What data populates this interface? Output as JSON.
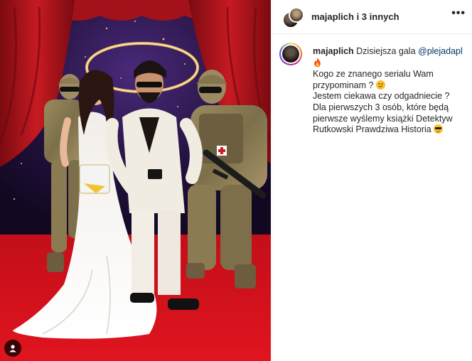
{
  "post": {
    "header": {
      "user_name": "majaplich i 3 innych",
      "more_icon": "more-horizontal-icon"
    },
    "caption": {
      "username": "majaplich",
      "intro": "Dzisiejsza gala",
      "mention": "@plejadapl",
      "line1": "Kogo ze znanego serialu Wam przypominam ?",
      "line2": "Jestem ciekawa czy odgadniecie ?",
      "line3": "Dla pierwszych 3 osób, które będą pierwsze wyślemy książki Detektyw Rutkowski Prawdziwa Historia"
    },
    "photo": {
      "tag_icon": "user-tag-icon",
      "colors": {
        "curtain": "#b3121b",
        "carpet": "#d7101c",
        "backdrop": "#2a1340"
      }
    }
  }
}
